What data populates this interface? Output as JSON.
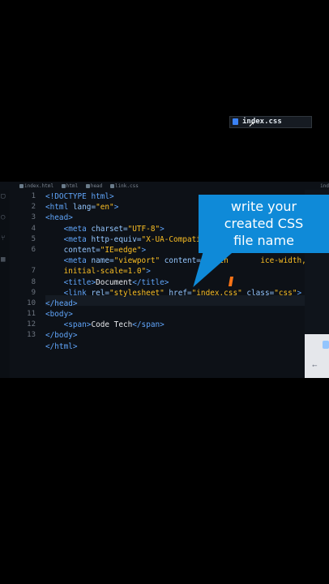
{
  "breadcrumb": {
    "items": [
      "index.html",
      "html",
      "head",
      "link.css"
    ],
    "right": "ind"
  },
  "code": {
    "line_numbers": [
      "1",
      "2",
      "3",
      "4",
      "5",
      "6",
      "",
      "7",
      "8",
      "9",
      "10",
      "11",
      "12",
      "13"
    ],
    "lines": [
      {
        "tokens": [
          {
            "t": "<!DOCTYPE html>",
            "c": "tag"
          }
        ]
      },
      {
        "tokens": [
          {
            "t": "<html ",
            "c": "tag"
          },
          {
            "t": "lang=",
            "c": "attr"
          },
          {
            "t": "\"en\"",
            "c": "val"
          },
          {
            "t": ">",
            "c": "tag"
          }
        ]
      },
      {
        "tokens": [
          {
            "t": "<head>",
            "c": "tag"
          }
        ]
      },
      {
        "tokens": [
          {
            "t": "    <meta ",
            "c": "tag"
          },
          {
            "t": "charset=",
            "c": "attr"
          },
          {
            "t": "\"UTF-8\"",
            "c": "val"
          },
          {
            "t": ">",
            "c": "tag"
          }
        ]
      },
      {
        "tokens": [
          {
            "t": "    <meta ",
            "c": "tag"
          },
          {
            "t": "http-equiv=",
            "c": "attr"
          },
          {
            "t": "\"X-UA-Compatib",
            "c": "val"
          }
        ]
      },
      {
        "tokens": [
          {
            "t": "    content=",
            "c": "attr"
          },
          {
            "t": "\"IE=edge\"",
            "c": "val"
          },
          {
            "t": ">",
            "c": "tag"
          }
        ]
      },
      {
        "tokens": [
          {
            "t": "    <meta ",
            "c": "tag"
          },
          {
            "t": "name=",
            "c": "attr"
          },
          {
            "t": "\"viewport\"",
            "c": "val"
          },
          {
            "t": " content=",
            "c": "attr"
          },
          {
            "t": "\"width",
            "c": "val"
          },
          {
            "t": "       ",
            "c": "txt"
          },
          {
            "t": "ice-width,",
            "c": "val"
          }
        ]
      },
      {
        "tokens": [
          {
            "t": "    initial-scale=1.0\"",
            "c": "val"
          },
          {
            "t": ">",
            "c": "tag"
          }
        ]
      },
      {
        "tokens": [
          {
            "t": "    <title>",
            "c": "tag"
          },
          {
            "t": "Document",
            "c": "txt"
          },
          {
            "t": "</title>",
            "c": "tag"
          }
        ]
      },
      {
        "tokens": [
          {
            "t": "    <link ",
            "c": "tag"
          },
          {
            "t": "rel=",
            "c": "attr"
          },
          {
            "t": "\"stylesheet\"",
            "c": "val"
          },
          {
            "t": " href=",
            "c": "attr"
          },
          {
            "t": "\"index.css\"",
            "c": "val"
          },
          {
            "t": " class=",
            "c": "attr"
          },
          {
            "t": "\"css\"",
            "c": "val"
          },
          {
            "t": ">",
            "c": "tag"
          }
        ]
      },
      {
        "tokens": [
          {
            "t": "</head>",
            "c": "tag"
          }
        ]
      },
      {
        "tokens": [
          {
            "t": "<body>",
            "c": "tag"
          }
        ]
      },
      {
        "tokens": [
          {
            "t": "    <span>",
            "c": "tag"
          },
          {
            "t": "Code Tech",
            "c": "txt"
          },
          {
            "t": "</span>",
            "c": "tag"
          }
        ]
      },
      {
        "tokens": [
          {
            "t": "</body>",
            "c": "tag"
          }
        ]
      },
      {
        "tokens": [
          {
            "t": "</html>",
            "c": "tag"
          }
        ]
      }
    ]
  },
  "suggestion": {
    "label": "index.css",
    "icon": "css-file-icon"
  },
  "callout": {
    "lines": [
      "write your",
      "created CSS",
      "file  name"
    ]
  },
  "colors": {
    "callout": "#0f8ad8",
    "tag": "#60a5fa",
    "value": "#fbbf24",
    "editor_bg": "#0d1117"
  }
}
